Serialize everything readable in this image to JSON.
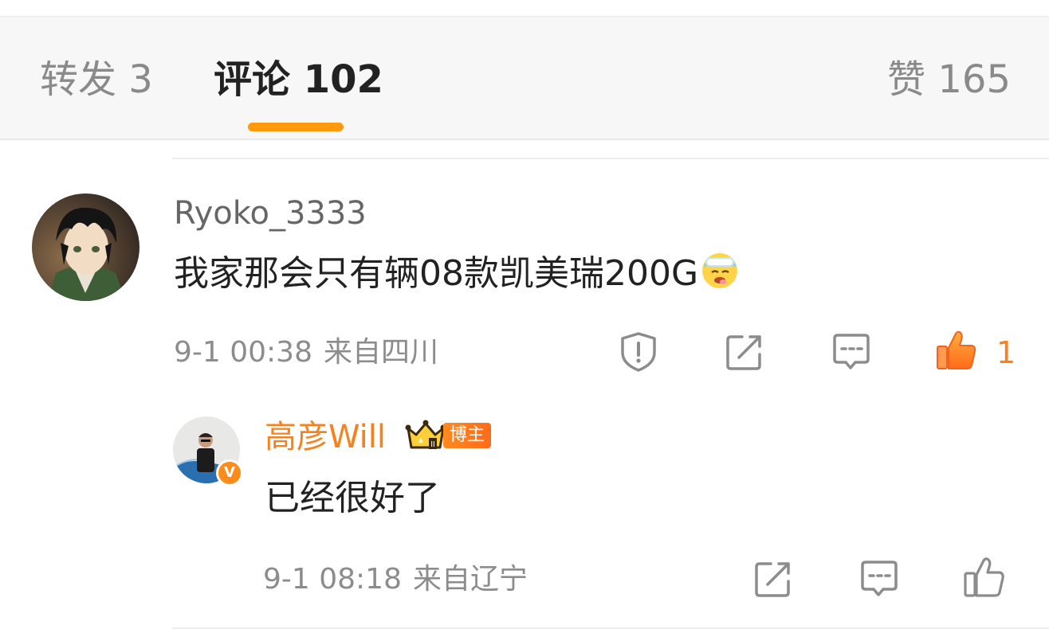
{
  "tabs": {
    "repost": "转发 3",
    "comments": "评论 102",
    "likes": "赞 165"
  },
  "comment": {
    "username": "Ryoko_3333",
    "text": "我家那会只有辆08款凯美瑞200G",
    "emoji": "sick-face-emoji",
    "time": "9-1 00:38",
    "location": "来自四川",
    "like_count": "1",
    "icons": [
      "report-icon",
      "share-icon",
      "reply-icon",
      "thumbs-up-icon"
    ],
    "accent_color": "#f5821f"
  },
  "reply": {
    "username": "高彦Will",
    "badge_label": "博主",
    "verified_mark": "V",
    "text": "已经很好了",
    "time": "9-1 08:18",
    "location": "来自辽宁",
    "icons": [
      "share-icon",
      "reply-icon",
      "thumbs-up-icon"
    ]
  }
}
